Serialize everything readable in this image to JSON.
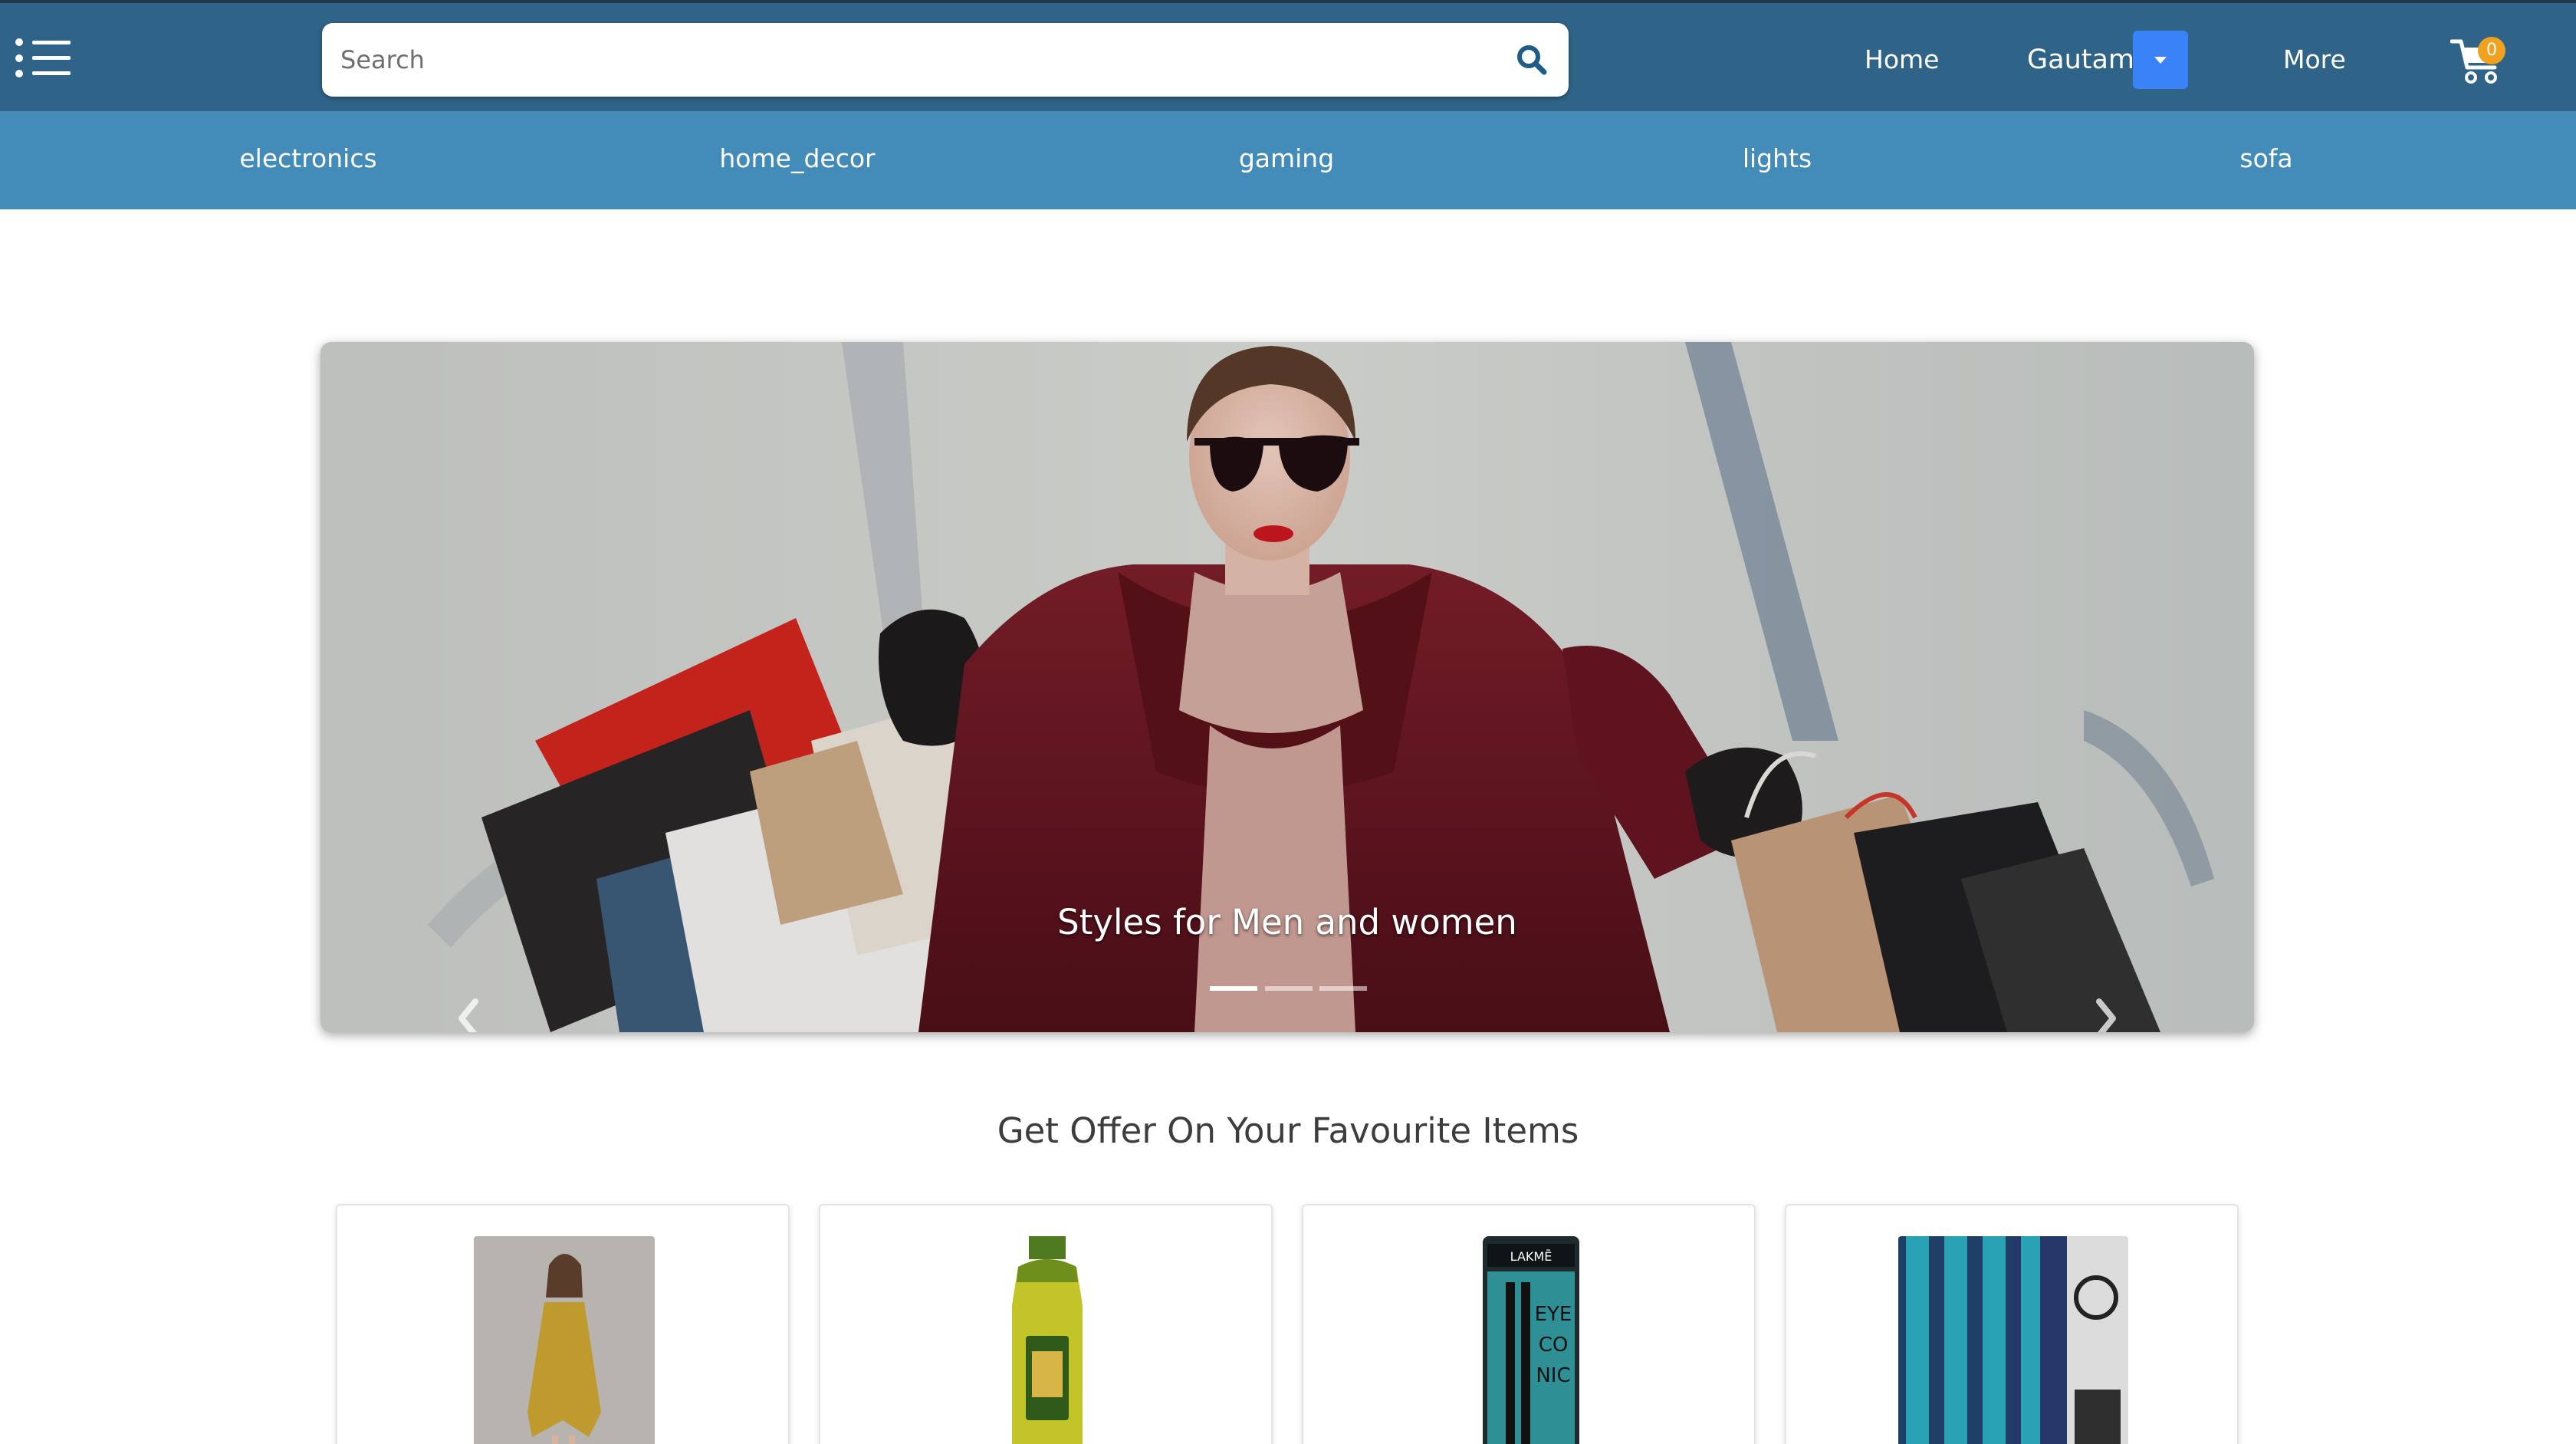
{
  "header": {
    "search_placeholder": "Search",
    "nav": {
      "home": "Home",
      "user": "Gautam",
      "more": "More"
    },
    "cart_count": "0"
  },
  "categories": [
    "electronics",
    "home_decor",
    "gaming",
    "lights",
    "sofa"
  ],
  "carousel": {
    "caption": "Styles for Men and women",
    "slide_count": 3,
    "active_slide": 0
  },
  "section": {
    "title": "Get Offer On Your Favourite Items"
  },
  "products": [
    {
      "image": "yellow dress"
    },
    {
      "image": "cooking oil bottle"
    },
    {
      "image": "kajal pencil"
    },
    {
      "image": "blue curtains"
    }
  ],
  "colors": {
    "header_bg": "#2f6388",
    "category_bar_bg": "#438bb8",
    "dropdown_accent": "#3a82f7",
    "cart_badge": "#f0a11e"
  }
}
